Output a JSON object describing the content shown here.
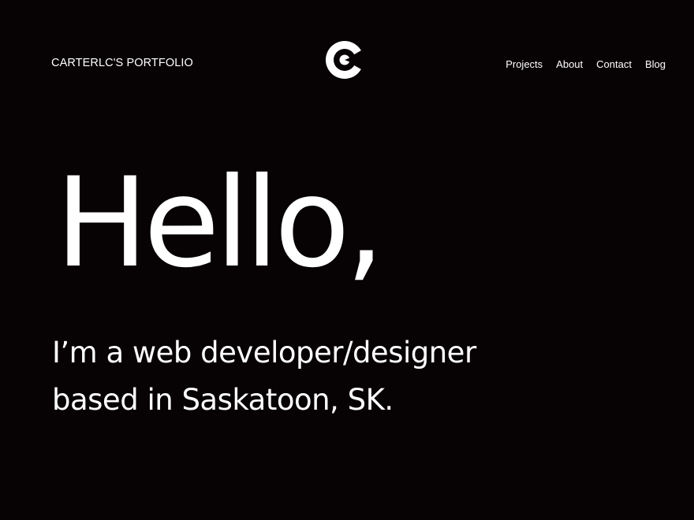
{
  "header": {
    "site_title": "CARTERLC'S PORTFOLIO",
    "logo_icon": "cc-monogram-logo-icon",
    "nav": [
      {
        "label": "Projects"
      },
      {
        "label": "About"
      },
      {
        "label": "Contact"
      },
      {
        "label": "Blog"
      }
    ]
  },
  "hero": {
    "greeting": "Hello,",
    "intro_line_1": "I’m a web developer/designer",
    "intro_line_2": "based in Saskatoon, SK."
  },
  "colors": {
    "background": "#070203",
    "text": "#ffffff"
  }
}
